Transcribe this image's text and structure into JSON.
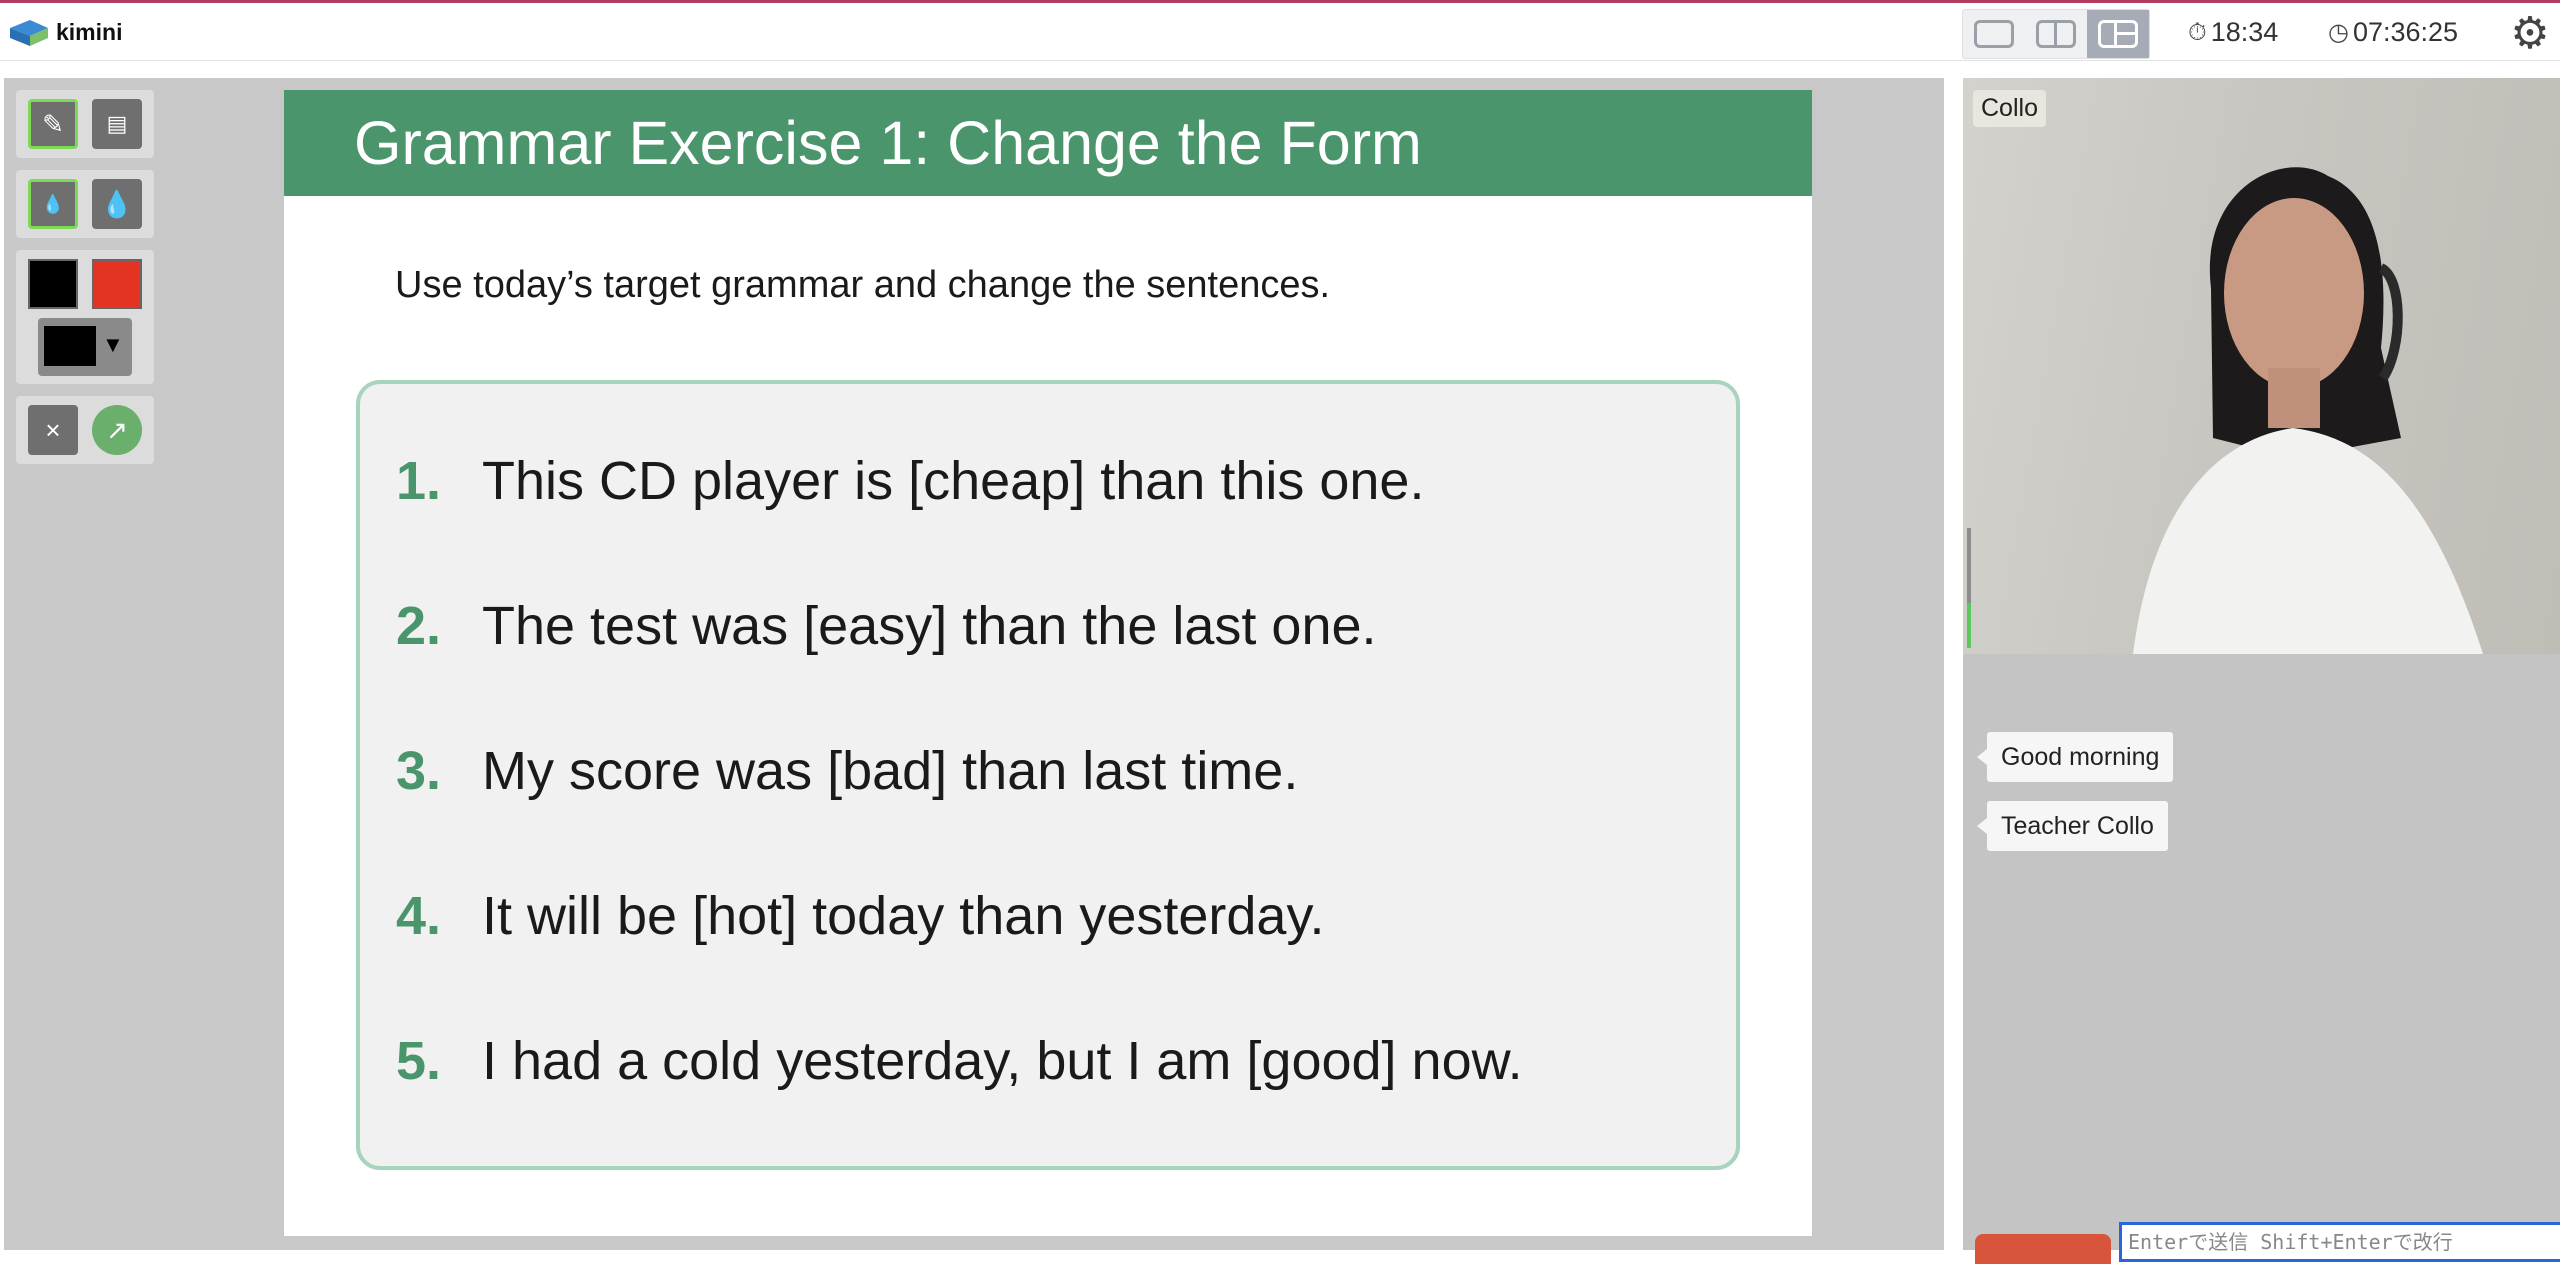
{
  "app": {
    "brand": "kimini"
  },
  "topbar": {
    "layouts": [
      "single",
      "split",
      "main-with-sub"
    ],
    "active_layout": "main-with-sub",
    "stopwatch": "18:34",
    "clock": "07:36:25"
  },
  "tools": {
    "pen": "pen-icon",
    "ruler": "ruler-icon",
    "thin_drop": "thin-drop-icon",
    "thick_drop": "thick-drop-icon",
    "colors": [
      "#000000",
      "#e53323"
    ],
    "selected_color": "#000000",
    "clear_label": "×",
    "pointer_label": "↗"
  },
  "slide": {
    "title": "Grammar Exercise 1: Change the Form",
    "instruction": "Use today’s target grammar and change the sentences.",
    "questions": [
      {
        "num": "1.",
        "text": "This CD player is [cheap] than this one."
      },
      {
        "num": "2.",
        "text": "The test was [easy] than the last one."
      },
      {
        "num": "3.",
        "text": "My score was [bad] than last time."
      },
      {
        "num": "4.",
        "text": "It will be [hot] today than yesterday."
      },
      {
        "num": "5.",
        "text": "I had a cold yesterday, but I am [good] now."
      }
    ],
    "accent": "#4a956b"
  },
  "video": {
    "name": "Collo"
  },
  "chat": {
    "messages": [
      "Good morning",
      "Teacher Collo"
    ],
    "placeholder": "Enterで送信 Shift+Enterで改行"
  }
}
